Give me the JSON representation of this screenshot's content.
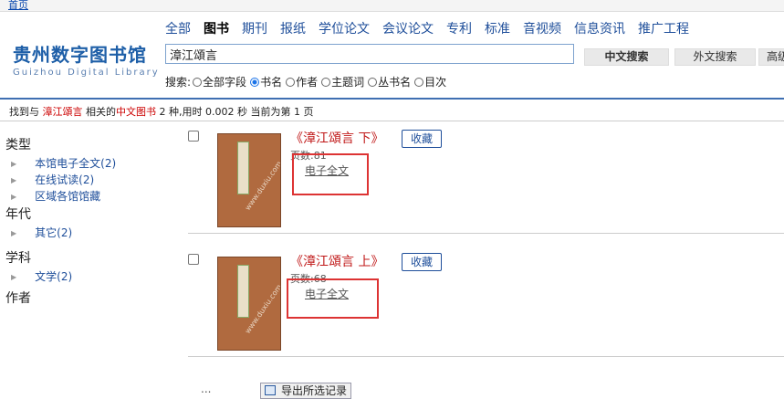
{
  "topbar": {
    "home_link": "首页"
  },
  "logo": {
    "cn": "贵州数字图书馆",
    "en": "Guizhou Digital Library"
  },
  "nav": {
    "items": [
      "全部",
      "图书",
      "期刊",
      "报纸",
      "学位论文",
      "会议论文",
      "专利",
      "标准",
      "音视频",
      "信息资讯",
      "推广工程"
    ],
    "active_index": 1
  },
  "search": {
    "query": "漳江頌言",
    "cn_button": "中文搜索",
    "foreign_button": "外文搜索",
    "advanced_button": "高级"
  },
  "search_options": {
    "label": "搜索:",
    "fields": [
      "全部字段",
      "书名",
      "作者",
      "主题词",
      "丛书名",
      "目次"
    ],
    "selected": "书名"
  },
  "summary": {
    "p1": "找到与",
    "query": "漳江頌言",
    "p2": "相关的",
    "category": "中文图书",
    "p3": "2 种,用时 0.002 秒 当前为第 1 页"
  },
  "facets": {
    "type_title": "类型",
    "type_items": [
      "本馆电子全文(2)",
      "在线试读(2)",
      "区域各馆馆藏"
    ],
    "era_title": "年代",
    "era_items": [
      "其它(2)"
    ],
    "subject_title": "学科",
    "subject_items": [
      "文学(2)"
    ],
    "author_title": "作者"
  },
  "results": [
    {
      "title": "《漳江頌言 下》",
      "favorite": "收藏",
      "pages": "页数:81",
      "fulltext": "电子全文",
      "cover_watermark": "www.duxiu.com"
    },
    {
      "title": "《漳江頌言 上》",
      "favorite": "收藏",
      "pages": "页数:68",
      "fulltext": "电子全文",
      "cover_watermark": "www.duxiu.com"
    }
  ],
  "footer": {
    "pager": "...",
    "export_label": "导出所选记录"
  },
  "colors": {
    "accent": "#1e4e9a",
    "highlight": "#c00000",
    "annotation": "#d33333",
    "cover": "#b06a3f"
  }
}
